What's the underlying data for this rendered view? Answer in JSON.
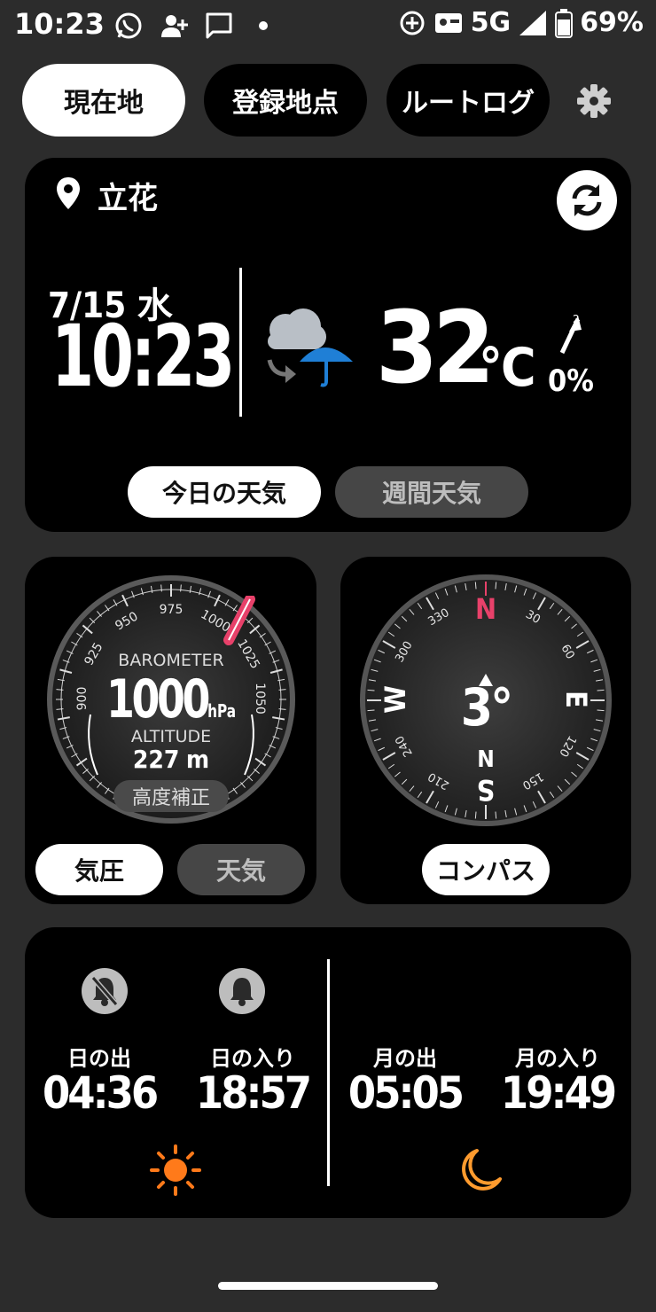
{
  "status": {
    "time": "10:23",
    "network": "5G",
    "battery": "69%"
  },
  "tabs": [
    {
      "label": "現在地",
      "active": true
    },
    {
      "label": "登録地点",
      "active": false
    },
    {
      "label": "ルートログ",
      "active": false
    }
  ],
  "weather": {
    "location": "立花",
    "date": "7/15 水",
    "time": "10:23",
    "temperature": "32",
    "unit": "°C",
    "precip_prob": "0%",
    "icons": [
      "cloud-icon",
      "umbrella-icon",
      "wind-arrow-icon"
    ],
    "tabs": [
      {
        "label": "今日の天気",
        "active": true
      },
      {
        "label": "週間天気",
        "active": false
      }
    ]
  },
  "barometer": {
    "label": "BAROMETER",
    "value": "1000",
    "unit": "hPa",
    "altitude_label": "ALTITUDE",
    "altitude_value": "227",
    "altitude_unit": "m",
    "calibrate_label": "高度補正",
    "scale_labels": [
      "900",
      "925",
      "950",
      "975",
      "1000",
      "1025",
      "1050"
    ],
    "tabs": [
      {
        "label": "気圧",
        "active": true
      },
      {
        "label": "天気",
        "active": false
      }
    ]
  },
  "compass": {
    "heading": "3°",
    "direction": "N",
    "cardinals": [
      "N",
      "E",
      "S",
      "W"
    ],
    "degree_labels": [
      "30",
      "60",
      "120",
      "150",
      "210",
      "240",
      "300",
      "330"
    ],
    "button_label": "コンパス"
  },
  "sun_moon": {
    "sunrise_label": "日の出",
    "sunrise_time": "04:36",
    "sunset_label": "日の入り",
    "sunset_time": "18:57",
    "moonrise_label": "月の出",
    "moonrise_time": "05:05",
    "moonset_label": "月の入り",
    "moonset_time": "19:49"
  },
  "colors": {
    "accent_red": "#e8416a",
    "weather_blue": "#1f7fd6",
    "orange": "#ff7a1a"
  }
}
